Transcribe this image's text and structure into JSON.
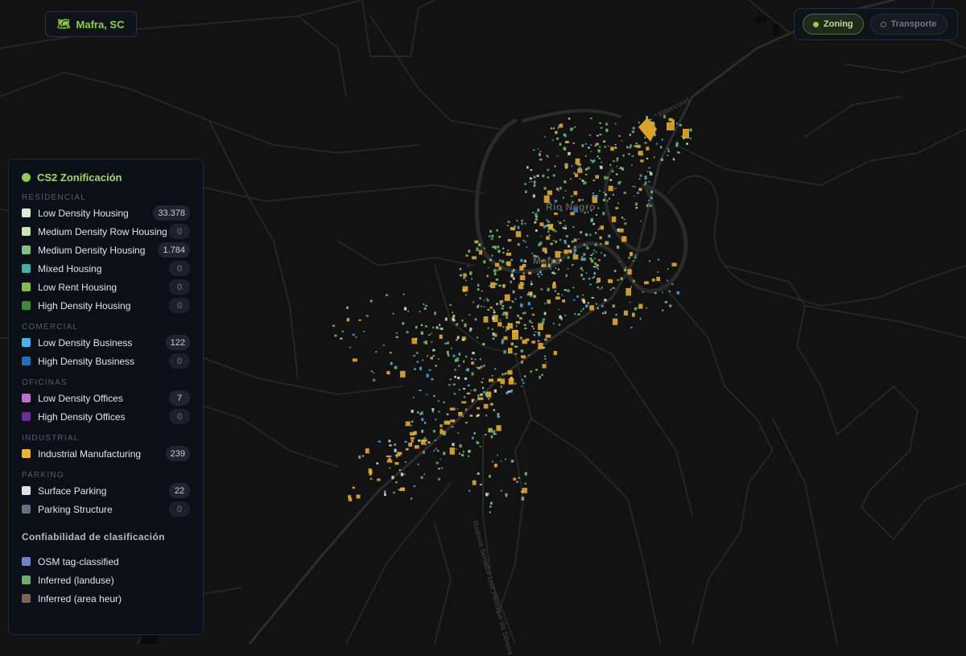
{
  "city_badge": {
    "icon": "map-icon",
    "label": "Mafra, SC"
  },
  "mode_toggle": {
    "options": [
      {
        "label": "Zoning",
        "active": true
      },
      {
        "label": "Transporte",
        "active": false
      }
    ]
  },
  "map": {
    "place_labels": [
      "Rio Negro",
      "Mafra"
    ],
    "road_labels": [
      "Bittencourt",
      "Rodovia Senador Luiz Henrique da Silveira"
    ]
  },
  "legend": {
    "title": "CS2 Zonificación",
    "groups": [
      {
        "label": "RESIDENCIAL",
        "items": [
          {
            "label": "Low Density Housing",
            "count": "33.378",
            "color": "#d4ecd0"
          },
          {
            "label": "Medium Density Row Housing",
            "count": "0",
            "color": "#c5e6b0"
          },
          {
            "label": "Medium Density Housing",
            "count": "1.784",
            "color": "#7cc47a"
          },
          {
            "label": "Mixed Housing",
            "count": "0",
            "color": "#41b0a3"
          },
          {
            "label": "Low Rent Housing",
            "count": "0",
            "color": "#86bd3e"
          },
          {
            "label": "High Density Housing",
            "count": "0",
            "color": "#3b8a34"
          }
        ]
      },
      {
        "label": "COMERCIAL",
        "items": [
          {
            "label": "Low Density Business",
            "count": "122",
            "color": "#42b4ee"
          },
          {
            "label": "High Density Business",
            "count": "0",
            "color": "#1a72c6"
          }
        ]
      },
      {
        "label": "OFICINAS",
        "items": [
          {
            "label": "Low Density Offices",
            "count": "7",
            "color": "#c46ad2"
          },
          {
            "label": "High Density Offices",
            "count": "0",
            "color": "#6b2d9a"
          }
        ]
      },
      {
        "label": "INDUSTRIAL",
        "items": [
          {
            "label": "Industrial Manufacturing",
            "count": "239",
            "color": "#f0b429"
          }
        ]
      },
      {
        "label": "PARKING",
        "items": [
          {
            "label": "Surface Parking",
            "count": "22",
            "color": "#dfe2e7"
          },
          {
            "label": "Parking Structure",
            "count": "0",
            "color": "#5c7580"
          }
        ]
      }
    ],
    "confidence": {
      "title": "Confiabilidad de clasificación",
      "items": [
        {
          "label": "OSM tag-classified",
          "color": "#6b86c8"
        },
        {
          "label": "Inferred (landuse)",
          "color": "#6aae6a"
        },
        {
          "label": "Inferred (area heur)",
          "color": "#7d6450"
        }
      ]
    }
  }
}
